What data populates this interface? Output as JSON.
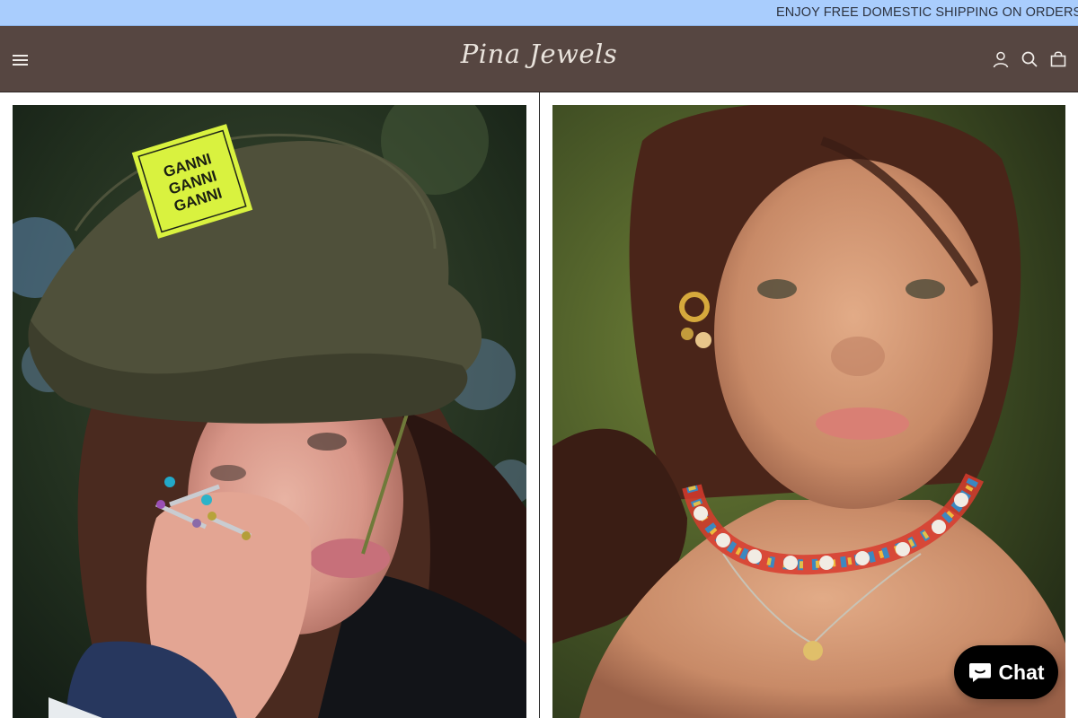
{
  "announcement": {
    "text": "ENJOY FREE DOMESTIC SHIPPING ON ORDERS O"
  },
  "header": {
    "logo": "Pina Jewels",
    "icons": [
      "menu-icon",
      "account-icon",
      "search-icon",
      "bag-icon"
    ]
  },
  "hero": {
    "left_image": {
      "hat_patch_text": "GANNI GANNI GANNI"
    },
    "right_image": {}
  },
  "chat": {
    "label": "Chat",
    "icon": "chat-bubble-icon"
  },
  "colors": {
    "announcement_bg": "#a9cdfd",
    "header_bg": "#564641",
    "header_text": "#e9e3dc",
    "chat_bg": "#000000"
  }
}
